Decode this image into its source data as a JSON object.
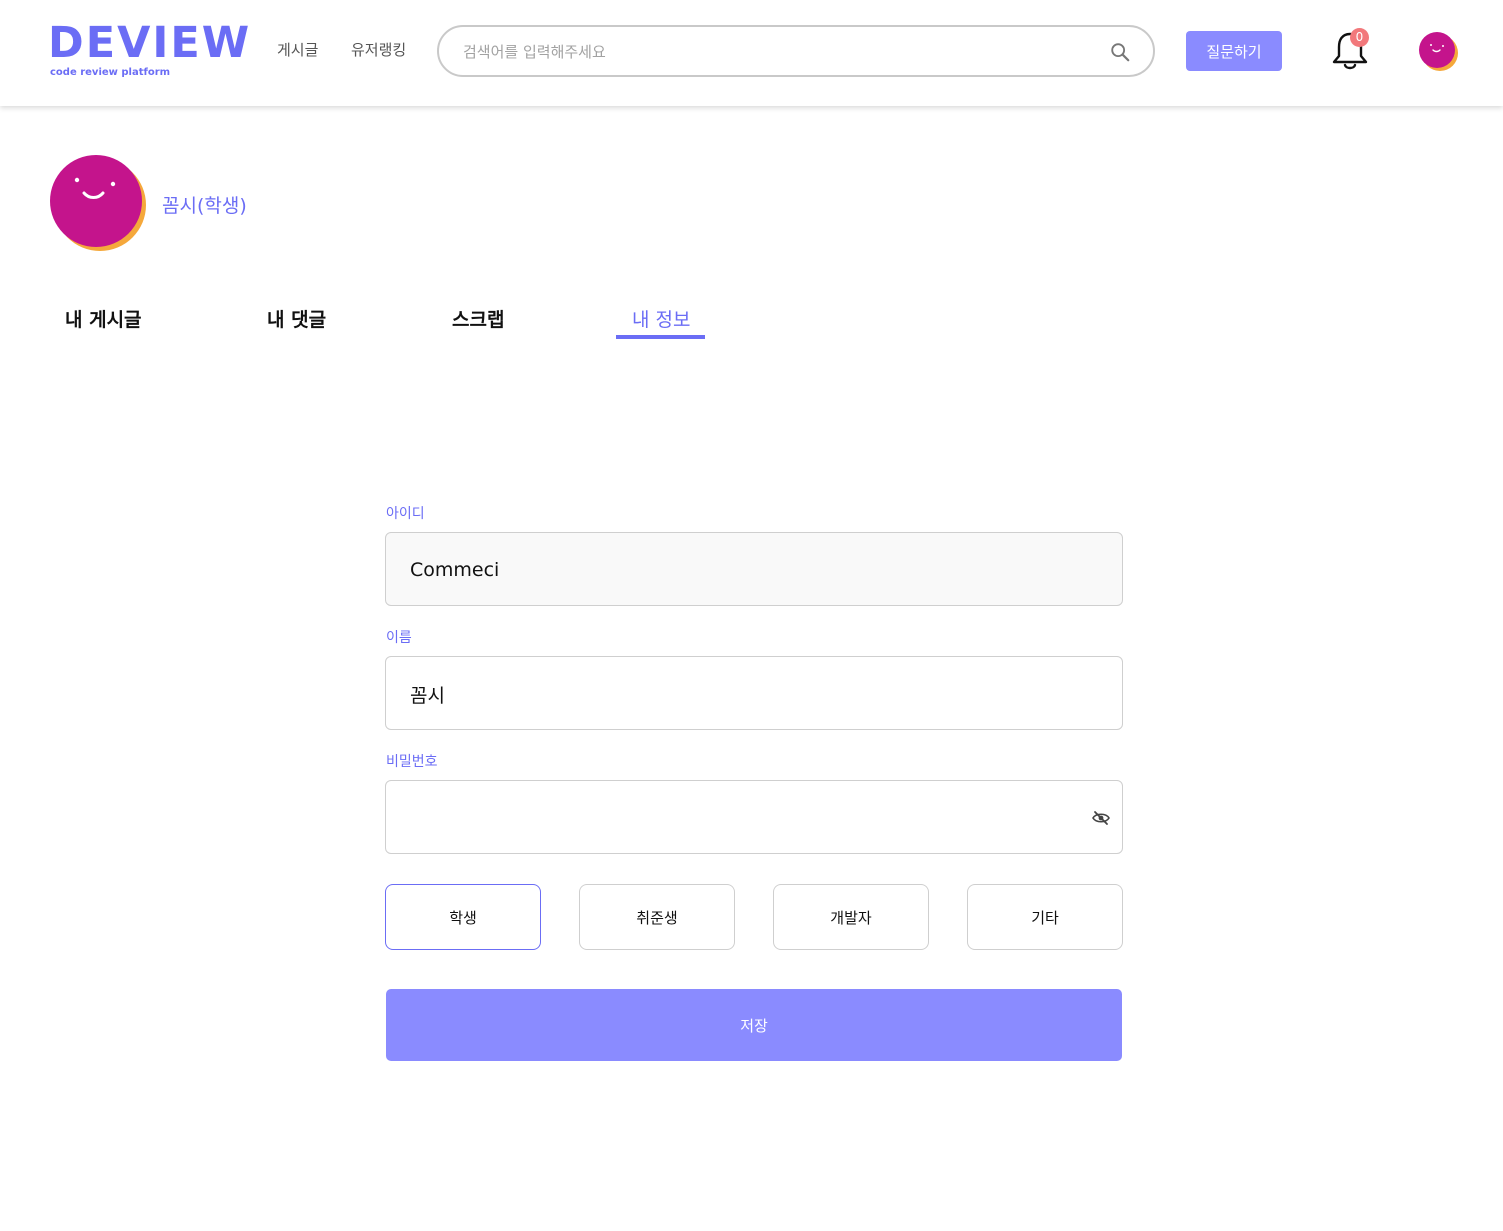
{
  "header": {
    "logo_text": "DEVIEW",
    "logo_sub": "code review platform",
    "nav": {
      "posts": "게시글",
      "ranking": "유저랭킹"
    },
    "search_placeholder": "검색어를 입력해주세요",
    "ask_button": "질문하기",
    "notification_count": "0"
  },
  "profile": {
    "display_name": "꼼시(학생)"
  },
  "tabs": [
    {
      "label": "내 게시글"
    },
    {
      "label": "내 댓글"
    },
    {
      "label": "스크랩"
    },
    {
      "label": "내 정보",
      "active": true
    }
  ],
  "form": {
    "id_label": "아이디",
    "id_value": "Commeci",
    "name_label": "이름",
    "name_value": "꼼시",
    "password_label": "비밀번호",
    "password_value": "",
    "roles": [
      {
        "label": "학생",
        "selected": true
      },
      {
        "label": "취준생"
      },
      {
        "label": "개발자"
      },
      {
        "label": "기타"
      }
    ],
    "save_button": "저장"
  },
  "colors": {
    "accent": "#6b6df5",
    "button": "#8a8bff",
    "avatar_primary": "#c4148c",
    "avatar_secondary": "#f5a83b",
    "badge": "#f2787b"
  },
  "icons": {
    "search": "search-icon",
    "bell": "bell-icon",
    "eye_off": "eye-off-icon"
  }
}
